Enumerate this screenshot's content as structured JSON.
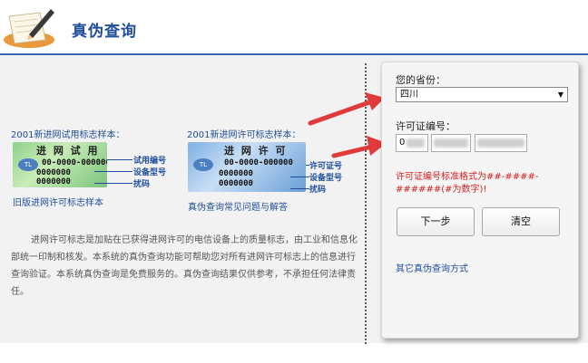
{
  "header": {
    "title": "真伪查询"
  },
  "samples": {
    "trial": {
      "title": "2001新进网试用标志样本：",
      "card_heading": "进 网 试 用",
      "code": "00-0000-000000",
      "line2": "0000000",
      "line3": "0000000",
      "annotations": [
        "试用编号",
        "设备型号",
        "扰码"
      ],
      "caption": "旧版进网许可标志样本"
    },
    "license": {
      "title": "2001新进网许可标志样本：",
      "card_heading": "进 网 许 可",
      "code": "00-0000-000000",
      "line2": "0000000",
      "line3": "0000000",
      "annotations": [
        "许可证号",
        "设备型号",
        "扰码"
      ],
      "caption": "真伪查询常见问题与解答"
    }
  },
  "description": "进网许可标志是加贴在已获得进网许可的电信设备上的质量标志，由工业和信息化部统一印制和核发。本系统的真伪查询功能可帮助您对所有进网许可标志上的信息进行查询验证。本系统真伪查询是免费服务的。真伪查询结果仅供参考，不承担任何法律责任。",
  "form": {
    "province_label": "您的省份：",
    "province_value": "四川",
    "license_label": "许可证编号：",
    "license_prefix": "0",
    "hint": "许可证编号标准格式为##-####-######(#为数字)!",
    "next_button": "下一步",
    "clear_button": "清空",
    "other_link": "其它真伪查询方式"
  },
  "colors": {
    "accent": "#1f4e9c",
    "hint": "#d42020",
    "arrow": "#e03a3a"
  }
}
